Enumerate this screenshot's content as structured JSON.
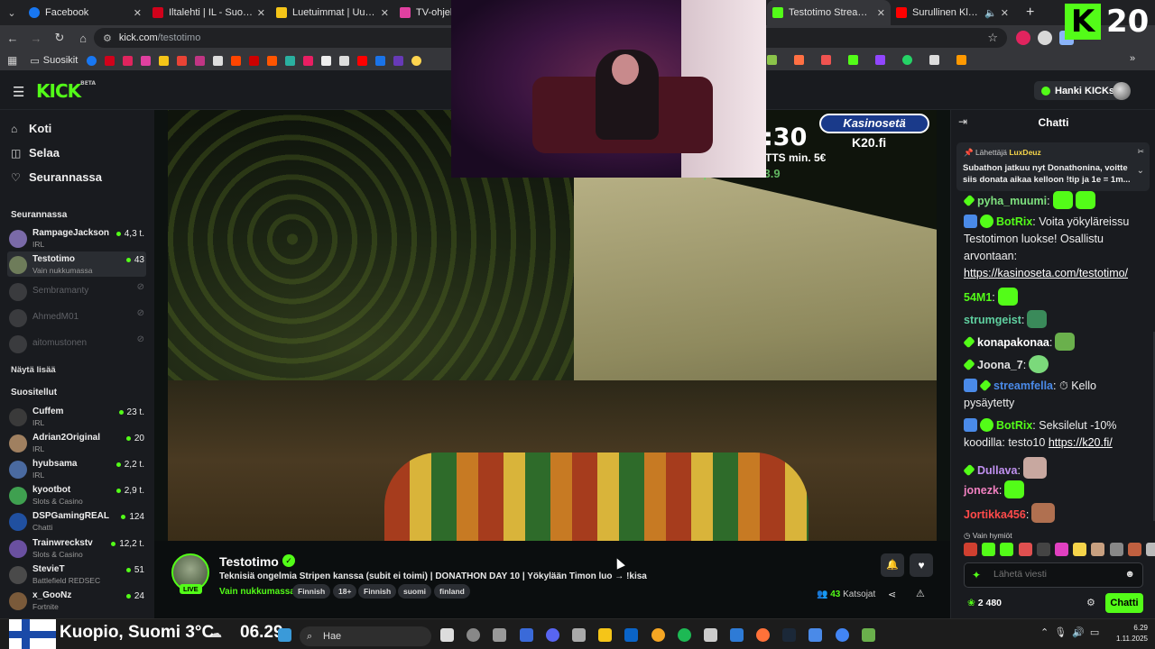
{
  "browser": {
    "tabs": [
      {
        "title": "Facebook",
        "color": "#1877f2"
      },
      {
        "title": "Iltalehti | IL - Suomen suu",
        "color": "#d0021b"
      },
      {
        "title": "Luetuimmat | Uutiset",
        "color": "#f5c518"
      },
      {
        "title": "TV-ohjelm",
        "color": "#e040a0"
      },
      {
        "title": "Testotimo Stream - Watch",
        "color": "#53fc18"
      },
      {
        "title": "Surullinen Klovni - Yo",
        "color": "#ff0000"
      }
    ],
    "url_host": "kick.com",
    "url_path": "/testotimo",
    "bookmarks_folder": "Suosikit"
  },
  "overlay": {
    "k20_letter": "K",
    "k20_number": "20",
    "timer": ":30",
    "tts_min": "TTS min. 5€",
    "tipped": "Tipsed: 17703.9",
    "kasino_brand": "Kasinosetä",
    "k20_site": "K20.fi"
  },
  "header": {
    "logo": "KICK",
    "logo_sup": "BETA",
    "kicks_button": "Hanki KICKs"
  },
  "sidebar": {
    "nav": [
      {
        "label": "Koti",
        "icon": "⌂"
      },
      {
        "label": "Selaa",
        "icon": "◫"
      },
      {
        "label": "Seurannassa",
        "icon": "♡"
      }
    ],
    "following_title": "Seurannassa",
    "following": [
      {
        "name": "RampageJackson",
        "category": "IRL",
        "viewers": "4,3 t.",
        "live": true,
        "color": "#7a6aa8"
      },
      {
        "name": "Testotimo",
        "category": "Vain nukkumassa",
        "viewers": "43",
        "live": true,
        "color": "#6e7c5a"
      },
      {
        "name": "Sembramanty",
        "category": "",
        "viewers": "",
        "live": false,
        "color": "#777"
      },
      {
        "name": "AhmedM01",
        "category": "",
        "viewers": "",
        "live": false,
        "color": "#777"
      },
      {
        "name": "aitomustonen",
        "category": "",
        "viewers": "",
        "live": false,
        "color": "#777"
      }
    ],
    "show_more": "Näytä lisää",
    "recommended_title": "Suositellut",
    "recommended": [
      {
        "name": "Cuffem",
        "category": "IRL",
        "viewers": "23 t.",
        "color": "#3a3a3a"
      },
      {
        "name": "Adrian2Original",
        "category": "IRL",
        "viewers": "20",
        "color": "#a08060"
      },
      {
        "name": "hyubsama",
        "category": "IRL",
        "viewers": "2,2 t.",
        "color": "#4a6aa0"
      },
      {
        "name": "kyootbot",
        "category": "Slots & Casino",
        "viewers": "2,9 t.",
        "color": "#3fa050"
      },
      {
        "name": "DSPGamingREAL",
        "category": "Chatti",
        "viewers": "124",
        "color": "#2050a0"
      },
      {
        "name": "Trainwreckstv",
        "category": "Slots & Casino",
        "viewers": "12,2 t.",
        "color": "#6a50a0"
      },
      {
        "name": "StevieT",
        "category": "Battlefield REDSEC",
        "viewers": "51",
        "color": "#4a4a4a"
      },
      {
        "name": "x_GooNz",
        "category": "Fortnite",
        "viewers": "24",
        "color": "#7a5a3a"
      }
    ]
  },
  "stream": {
    "name": "Testotimo",
    "live_label": "LIVE",
    "title": "Teknisiä ongelmia Stripen kanssa (subit ei toimi) | DONATHON DAY 10 | Yökylään Timon luo → !kisa",
    "category": "Vain nukkumassa",
    "tags": [
      "Finnish",
      "18+",
      "Finnish",
      "suomi",
      "finland"
    ],
    "viewers_count": "43",
    "viewers_label": "Katsojat"
  },
  "chat": {
    "title": "Chatti",
    "pinned_by_label": "Lähettäjä",
    "pinned_by": "LuxDeuz",
    "pinned_message": "Subathon jatkuu nyt Donathonina, voitte siis donata aikaa kelloon !tip ja 1e = 1m...",
    "messages": [
      {
        "user": "pyha_muumi",
        "color": "#7ee07e",
        "text": ""
      },
      {
        "user": "BotRix",
        "color": "#53fc18",
        "text": "Voita yökyläreissu Testotimon luokse! Osallistu arvontaan:",
        "link": "https://kasinoseta.com/testotimo/"
      },
      {
        "user": "54M1",
        "color": "#53fc18",
        "text": ""
      },
      {
        "user": "strumgeist",
        "color": "#5fd0a0",
        "text": ""
      },
      {
        "user": "konapakonaa",
        "color": "#ffffff",
        "text": ""
      },
      {
        "user": "Joona_7",
        "color": "#e0e0e0",
        "text": ""
      },
      {
        "user": "streamfella",
        "color": "#4a8ae8",
        "text": "⏱ Kello pysäytetty"
      },
      {
        "user": "BotRix",
        "color": "#53fc18",
        "text": "Seksilelut -10% koodilla: testo10",
        "link": "https://k20.fi/"
      },
      {
        "user": "Dullava",
        "color": "#c090f0",
        "text": ""
      },
      {
        "user": "jonezk",
        "color": "#f080c0",
        "text": ""
      },
      {
        "user": "Jortikka456",
        "color": "#ff4a4a",
        "text": ""
      }
    ],
    "emote_only": "Vain hymiöt",
    "input_placeholder": "Lähetä viesti",
    "kicks_balance": "2 480",
    "send_button": "Chatti"
  },
  "taskbar": {
    "weather": "Kuopio, Suomi 3°C",
    "clock_big": "06.29",
    "search": "Hae",
    "time": "6.29",
    "date": "1.11.2025"
  }
}
